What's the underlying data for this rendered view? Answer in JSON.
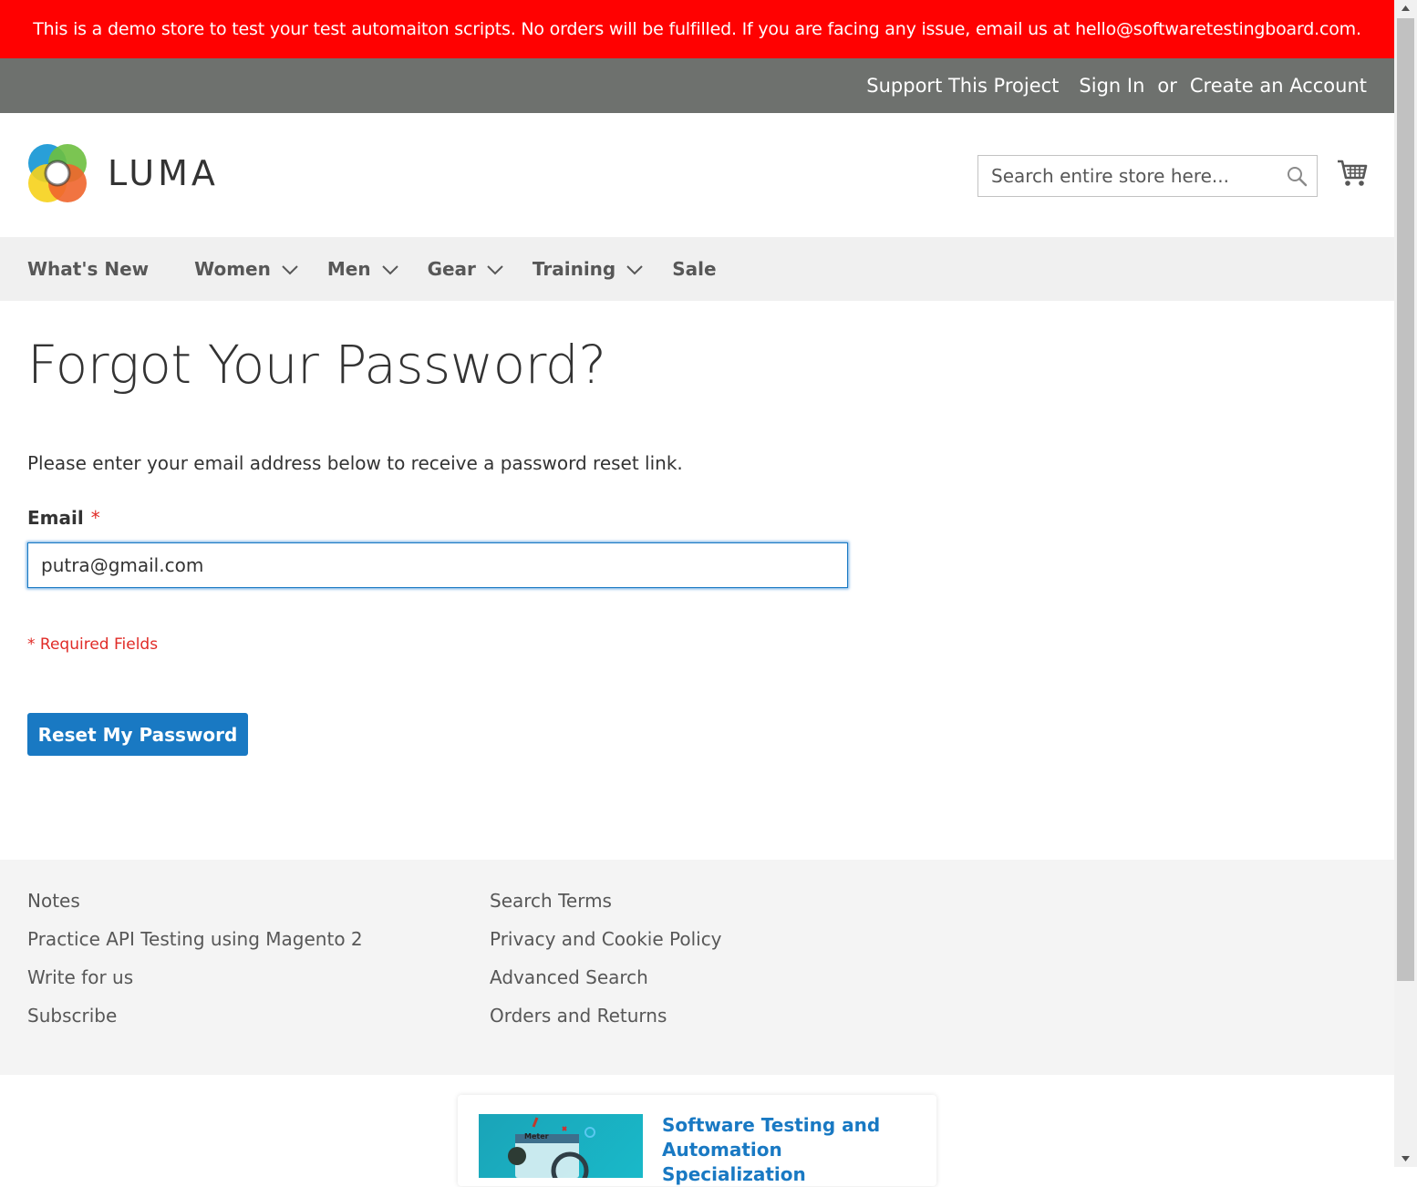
{
  "banner": {
    "text": "This is a demo store to test your test automaiton scripts. No orders will be fulfilled. If you are facing any issue, email us at hello@softwaretestingboard.com."
  },
  "top_links": {
    "support": "Support This Project",
    "sign_in": "Sign In",
    "or": "or",
    "create_account": "Create an Account"
  },
  "header": {
    "logo_text": "LUMA",
    "search_placeholder": "Search entire store here..."
  },
  "nav": {
    "items": [
      {
        "label": "What's New",
        "has_dropdown": false
      },
      {
        "label": "Women",
        "has_dropdown": true
      },
      {
        "label": "Men",
        "has_dropdown": true
      },
      {
        "label": "Gear",
        "has_dropdown": true
      },
      {
        "label": "Training",
        "has_dropdown": true
      },
      {
        "label": "Sale",
        "has_dropdown": false
      }
    ]
  },
  "main": {
    "title": "Forgot Your Password?",
    "intro": "Please enter your email address below to receive a password reset link.",
    "email_label": "Email",
    "required_mark": "*",
    "email_value": "putra@gmail.com",
    "required_note": "* Required Fields",
    "reset_button": "Reset My Password"
  },
  "footer": {
    "left_links": [
      "Notes",
      "Practice API Testing using Magento 2",
      "Write for us",
      "Subscribe"
    ],
    "right_links": [
      "Search Terms",
      "Privacy and Cookie Policy",
      "Advanced Search",
      "Orders and Returns"
    ]
  },
  "ad": {
    "title": "Software Testing and Automation Specialization",
    "thumb_text": "Meter"
  },
  "colors": {
    "banner_red": "#ff0101",
    "top_bar": "#6e716e",
    "primary_blue": "#1979c3",
    "required_red": "#e02b27",
    "nav_bg": "#f0f0f0",
    "footer_bg": "#f4f4f4"
  }
}
